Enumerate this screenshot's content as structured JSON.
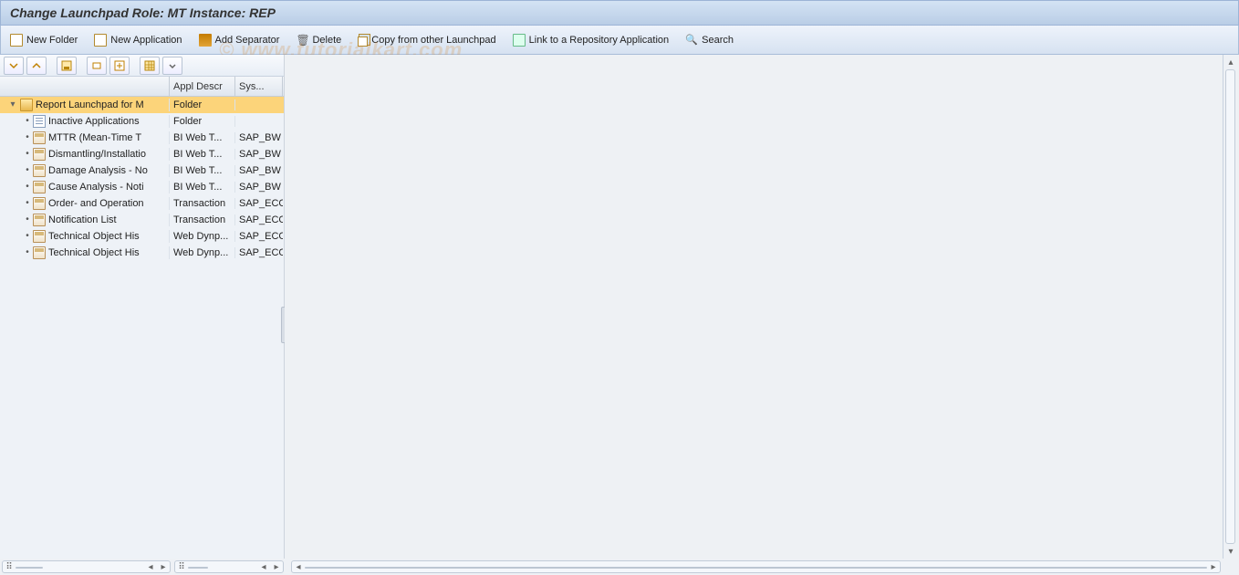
{
  "title": "Change Launchpad Role: MT Instance: REP",
  "toolbar": {
    "new_folder": "New Folder",
    "new_application": "New Application",
    "add_separator": "Add Separator",
    "delete": "Delete",
    "copy_from_other": "Copy from other Launchpad",
    "link_repo": "Link to a Repository Application",
    "search": "Search"
  },
  "tree_header": {
    "col_name": "",
    "col_appl_descr": "Appl Descr",
    "col_sys": "Sys..."
  },
  "tree": [
    {
      "indent": 0,
      "expander": "▾",
      "icon": "folder-open",
      "label": "Report Launchpad for M",
      "col1": "Folder",
      "col2": "",
      "selected": true
    },
    {
      "indent": 1,
      "expander": "•",
      "icon": "folder-doc",
      "label": "Inactive Applications",
      "col1": "Folder",
      "col2": ""
    },
    {
      "indent": 1,
      "expander": "•",
      "icon": "app",
      "label": "MTTR (Mean-Time T",
      "col1": "BI Web T...",
      "col2": "SAP_BW"
    },
    {
      "indent": 1,
      "expander": "•",
      "icon": "app",
      "label": "Dismantling/Installatio",
      "col1": "BI Web T...",
      "col2": "SAP_BW"
    },
    {
      "indent": 1,
      "expander": "•",
      "icon": "app",
      "label": "Damage Analysis - No",
      "col1": "BI Web T...",
      "col2": "SAP_BW"
    },
    {
      "indent": 1,
      "expander": "•",
      "icon": "app",
      "label": "Cause Analysis - Noti",
      "col1": "BI Web T...",
      "col2": "SAP_BW"
    },
    {
      "indent": 1,
      "expander": "•",
      "icon": "app",
      "label": "Order- and Operation",
      "col1": "Transaction",
      "col2": "SAP_ECC"
    },
    {
      "indent": 1,
      "expander": "•",
      "icon": "app",
      "label": "Notification List",
      "col1": "Transaction",
      "col2": "SAP_ECC"
    },
    {
      "indent": 1,
      "expander": "•",
      "icon": "app",
      "label": "Technical Object His",
      "col1": "Web Dynp...",
      "col2": "SAP_ECC"
    },
    {
      "indent": 1,
      "expander": "•",
      "icon": "app",
      "label": "Technical Object His",
      "col1": "Web Dynp...",
      "col2": "SAP_ECC"
    }
  ],
  "watermark": "© www.tutorialkart.com"
}
